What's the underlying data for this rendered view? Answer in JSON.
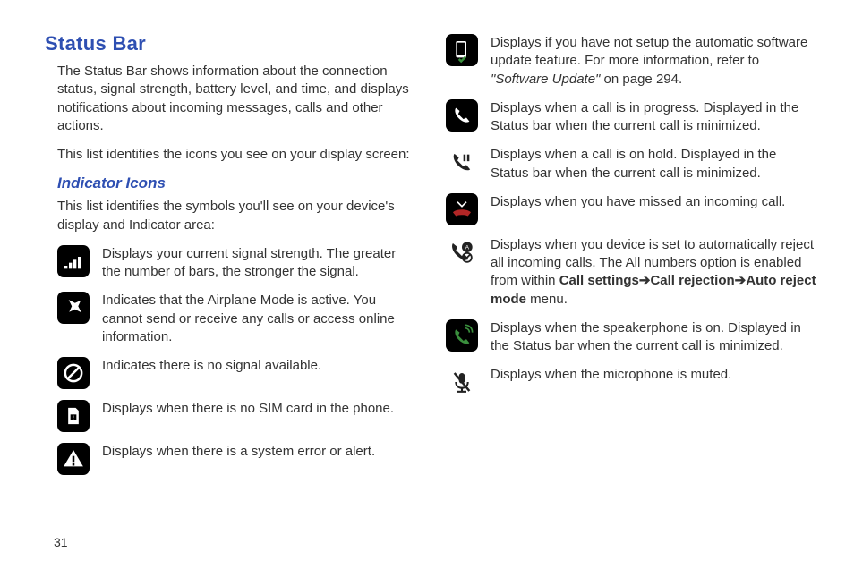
{
  "page_number": "31",
  "title": "Status Bar",
  "intro1": "The Status Bar shows information about the connection status, signal strength, battery level, and time, and displays notifications about incoming messages, calls and other actions.",
  "intro2": "This list identifies the icons you see on your display screen:",
  "subtitle": "Indicator Icons",
  "sub_intro": "This list identifies the symbols you'll see on your device's display and Indicator area:",
  "left": [
    {
      "id": "signal",
      "text": "Displays your current signal strength. The greater the number of bars, the stronger the signal."
    },
    {
      "id": "airplane",
      "text": "Indicates that the Airplane Mode is active. You cannot send or receive any calls or access online information."
    },
    {
      "id": "no-signal",
      "text": "Indicates there is no signal available."
    },
    {
      "id": "no-sim",
      "text": "Displays when there is no SIM card in the phone."
    },
    {
      "id": "alert",
      "text": "Displays when there is a system error or alert."
    }
  ],
  "right": [
    {
      "id": "sw-update",
      "text_a": "Displays if you have not setup the automatic software update feature. For more information, refer to ",
      "ital": "\"Software Update\"",
      "text_b": "  on page 294."
    },
    {
      "id": "call",
      "text": "Displays when a call is in progress. Displayed in the Status bar when the current call is minimized."
    },
    {
      "id": "hold",
      "text": "Displays when a call is on hold. Displayed in the Status bar when the current call is minimized."
    },
    {
      "id": "missed",
      "text": "Displays when you have missed an incoming call."
    },
    {
      "id": "reject",
      "text_a": "Displays when you device is set to automatically reject all incoming calls. The All numbers option is enabled from within ",
      "b1": "Call settings",
      "arrow": " ➔ ",
      "b2": "Call rejection",
      "arrow2": " ➔ ",
      "b3": "Auto reject mode",
      "text_b": " menu."
    },
    {
      "id": "speaker",
      "text": "Displays when the speakerphone is on. Displayed in the Status bar when the current call is minimized."
    },
    {
      "id": "mute",
      "text": "Displays when the microphone is muted."
    }
  ]
}
